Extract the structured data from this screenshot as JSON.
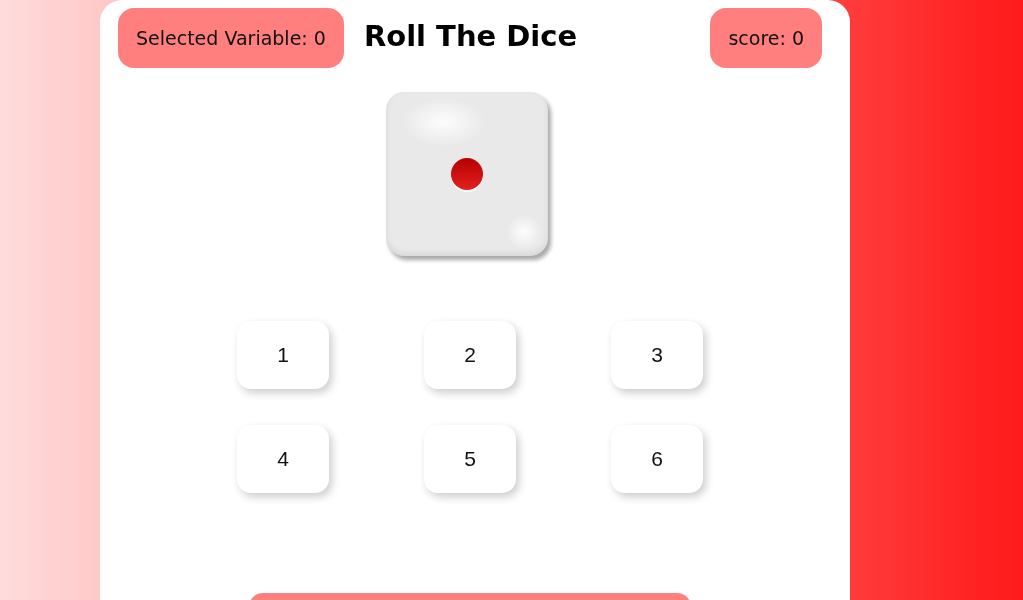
{
  "header": {
    "selected_variable": "Selected Variable: 0",
    "title": "Roll The Dice",
    "score": "score: 0"
  },
  "dice": {
    "kind": "one"
  },
  "number_buttons": [
    "1",
    "2",
    "3",
    "4",
    "5",
    "6"
  ]
}
